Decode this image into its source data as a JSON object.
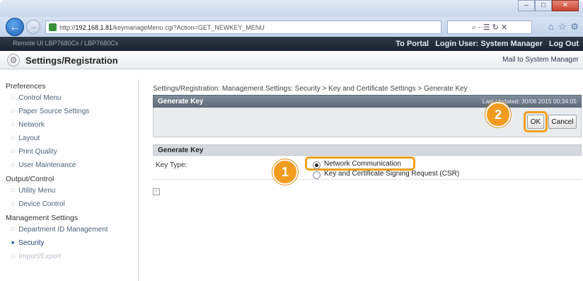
{
  "browser": {
    "url_prefix": "http://",
    "url_host": "192.168.1.81",
    "url_path": "/keymanageMenu.cgi?Action=GET_NEWKEY_MENU",
    "url_tools": "⌕ - ☰ ↻ ✕",
    "win_min": "–",
    "win_max": "□",
    "win_close": "✕",
    "icons": [
      "home-icon",
      "star-icon",
      "gear-icon"
    ]
  },
  "header": {
    "brand": "Remote UI      LBP7680Cx / LBP7680Cx",
    "to_portal": "To Portal",
    "login_user": "Login User: System Manager",
    "logout": "Log Out",
    "page_title": "Settings/Registration",
    "mail_link": "Mail to System Manager"
  },
  "sidebar": {
    "groups": [
      {
        "title": "Preferences",
        "items": [
          "Control Menu",
          "Paper Source Settings",
          "Network",
          "Layout",
          "Print Quality",
          "User Maintenance"
        ]
      },
      {
        "title": "Output/Control",
        "items": [
          "Utility Menu",
          "Device Control"
        ]
      },
      {
        "title": "Management Settings",
        "items": [
          "Department ID Management",
          "Security",
          "Import/Export"
        ]
      }
    ],
    "active_item": "Security"
  },
  "main": {
    "breadcrumb": "Settings/Registration: Management Settings: Security > Key and Certificate Settings > Generate Key",
    "panel_title": "Generate Key",
    "last_updated": "Last Updated: 30/06 2015 00:34:05",
    "ok_label": "OK",
    "cancel_label": "Cancel",
    "section_title": "Generate Key",
    "key_type_label": "Key Type:",
    "option_1": "Network Communication",
    "option_2": "Key and Certificate Signing Request (CSR)",
    "selected_option": "Network Communication",
    "top_link": "↑"
  },
  "callouts": {
    "step_1": "1",
    "step_2": "2",
    "color": "#f39b1e"
  }
}
